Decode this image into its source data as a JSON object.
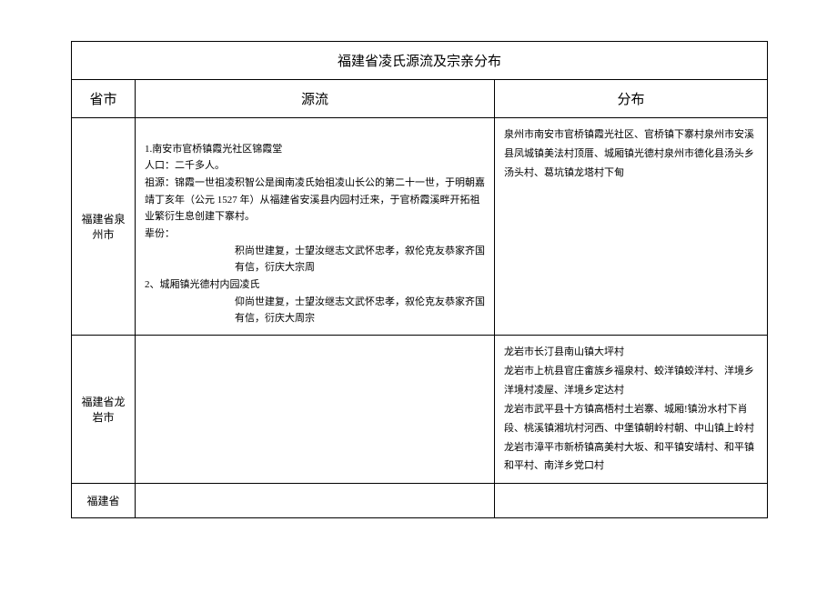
{
  "title": "福建省凌氏源流及宗亲分布",
  "headers": {
    "province": "省市",
    "source": "源流",
    "distribution": "分布"
  },
  "rows": [
    {
      "province": "福建省泉州市",
      "source": {
        "l1": "1.南安市官桥镇霞光社区锦霞堂",
        "l2": "人口：二千多人。",
        "l3": "祖源：锦霞一世祖凌积智公是闽南凌氏始祖凌山长公的第二十一世，于明朝嘉靖丁亥年（公元 1527 年）从福建省安溪县内园村迁来，于官桥霞溪畔开拓祖业繁衍生息创建下寨村。",
        "l4": "辈份：",
        "l5": "积尚世建复，士望汝继志文武怀忠孝，叙伦克友恭家齐国有信，衍庆大宗周",
        "l6": "2、城厢镇光德村内园凌氏",
        "l7": "仰尚世建复，士望汝继志文武怀忠孝，叙伦克友恭家齐国有信，衍庆大周宗"
      },
      "distribution": "泉州市南安市官桥镇霞光社区、官桥镇下寨村泉州市安溪县凤城镇美法村顶厝、城厢镇光德村泉州市德化县汤头乡汤头村、葛坑镇龙塔村下甸"
    },
    {
      "province": "福建省龙岩市",
      "source": "",
      "distribution": {
        "l1": "龙岩市长汀县南山镇大坪村",
        "l2": "龙岩市上杭县官庄畲族乡福泉村、蛟洋镇蛟洋村、洋境乡洋境村凌屋、洋境乡定达村",
        "l3": "龙岩市武平县十方镇高梧村土岩寨、城厢!镇汾水村下肖段、桃溪镇湘坑村河西、中堡镇朝岭村朝、中山镇上岭村",
        "l4": "龙岩市漳平市新桥镇高美村大坂、和平镇安靖村、和平镇和平村、南洋乡党口村"
      }
    },
    {
      "province": "福建省",
      "source": "",
      "distribution": ""
    }
  ]
}
